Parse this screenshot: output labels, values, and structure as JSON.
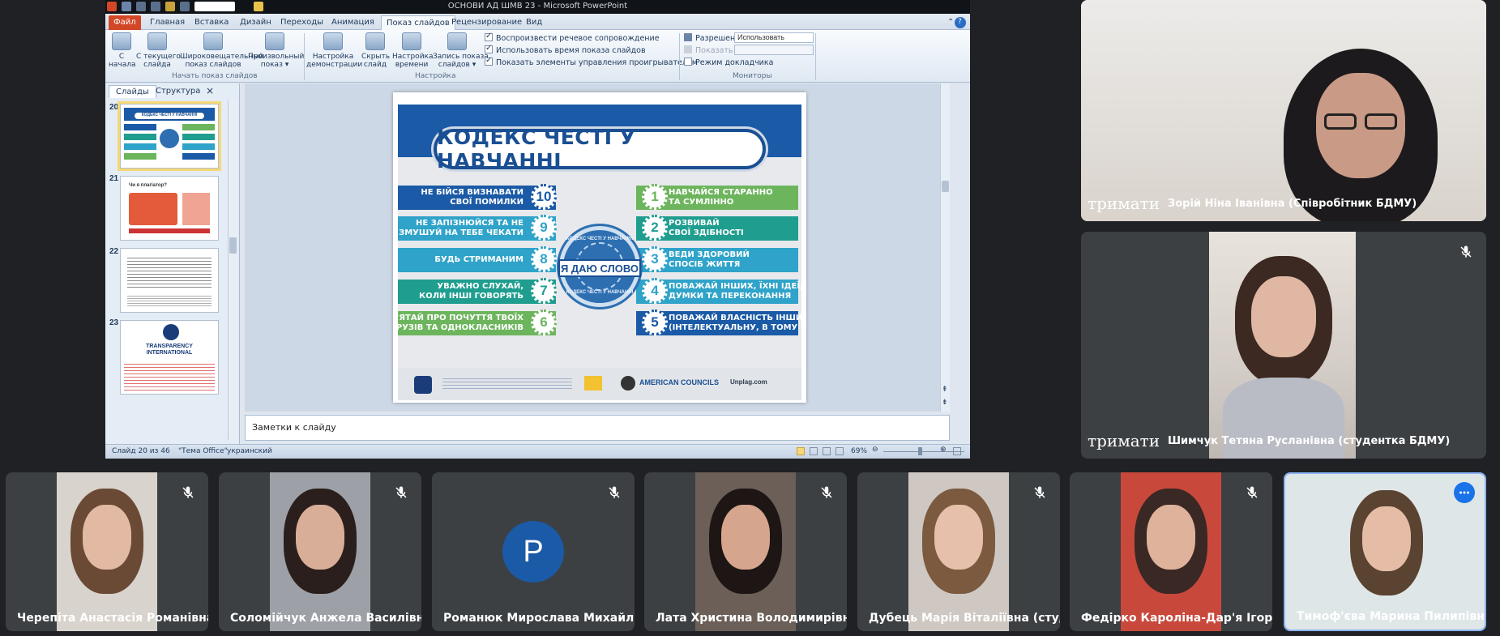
{
  "ppt": {
    "window_title": "ОСНОВИ АД ШМВ 23  -  Microsoft PowerPoint",
    "tabs": [
      "Файл",
      "Главная",
      "Вставка",
      "Дизайн",
      "Переходы",
      "Анимация",
      "Показ слайдов",
      "Рецензирование",
      "Вид"
    ],
    "active_tab": "Показ слайдов",
    "ribbon": {
      "btn_from_start": "С\nначала",
      "btn_current": "С текущего\nслайда",
      "btn_broadcast": "Широковещательный\nпоказ слайдов",
      "btn_custom": "Произвольный\nпоказ ▾",
      "group1": "Начать показ слайдов",
      "btn_setup": "Настройка\nдемонстрации",
      "btn_hide": "Скрыть\nслайд",
      "btn_timing": "Настройка\nвремени",
      "btn_record": "Запись показа\nслайдов ▾",
      "chk1": "Воспроизвести речевое сопровождение",
      "chk2": "Использовать время показа слайдов",
      "chk3": "Показать элементы управления проигрывателем",
      "group2": "Настройка",
      "resolution_label": "Разрешение:",
      "resolution_value": "Использовать текуще...",
      "show_on_label": "Показать на:",
      "presenter_view": "Режим докладчика",
      "group3": "Мониторы"
    },
    "pane": {
      "tab_slides": "Слайды",
      "tab_outline": "Структура",
      "close": "×",
      "slides": [
        "20",
        "21",
        "22",
        "23"
      ],
      "thumb20_title": "КОДЕКС ЧЕСТІ У НАВЧАННІ",
      "thumb21_title": "Чи я плагіатор?",
      "thumb23_org": "TRANSPARENCY INTERNATIONAL"
    },
    "slide": {
      "title": "КОДЕКС ЧЕСТІ У НАВЧАННІ",
      "seal_text": "Я ДАЮ СЛОВО",
      "seal_ring": "КОДЕКС ЧЕСТІ У НАВЧАННІ",
      "items_left": [
        {
          "num": "10",
          "text": "НЕ БІЙСЯ ВИЗНАВАТИ\nСВОЇ ПОМИЛКИ"
        },
        {
          "num": "9",
          "text": "НЕ ЗАПІЗНЮЙСЯ ТА НЕ\nЗМУШУЙ НА ТЕБЕ ЧЕКАТИ"
        },
        {
          "num": "8",
          "text": "БУДЬ СТРИМАНИМ"
        },
        {
          "num": "7",
          "text": "УВАЖНО СЛУХАЙ,\nКОЛИ ІНШІ ГОВОРЯТЬ"
        },
        {
          "num": "6",
          "text": "ПАМ'ЯТАЙ ПРО ПОЧУТТЯ ТВОЇХ\nДРУЗІВ ТА ОДНОКЛАСНИКІВ"
        }
      ],
      "items_right": [
        {
          "num": "1",
          "text": "НАВЧАЙСЯ СТАРАННО\nТА СУМЛІННО"
        },
        {
          "num": "2",
          "text": "РОЗВИВАЙ\nСВОЇ ЗДІБНОСТІ"
        },
        {
          "num": "3",
          "text": "ВЕДИ ЗДОРОВИЙ\nСПОСІБ ЖИТТЯ"
        },
        {
          "num": "4",
          "text": "ПОВАЖАЙ ІНШИХ, ЇХНІ ІДЕЇ,\nДУМКИ ТА ПЕРЕКОНАННЯ"
        },
        {
          "num": "5",
          "text": "ПОВАЖАЙ ВЛАСНІСТЬ ІНШИХ\n(ІНТЕЛЕКТУАЛЬНУ, В ТОМУ ЧИСЛІ)"
        }
      ],
      "footer_logos": [
        "AMERICAN COUNCILS",
        "Unplag.com"
      ]
    },
    "notes_placeholder": "Заметки к слайду",
    "status": {
      "slide_of": "Слайд 20 из 46",
      "theme": "\"Тема Office\"",
      "language": "украинский",
      "zoom": "69%"
    },
    "colors": {
      "blue": "#1a5aa6",
      "teal": "#1f9d8f",
      "green": "#6db55d",
      "lightblue": "#2fa3c9",
      "darkblue": "#1a4f93"
    }
  },
  "participants": {
    "hold_label": "тримати",
    "top1": "Зорій Ніна Іванівна (Співробітник БДМУ)",
    "top2": "Шимчук Тетяна Русланівна (студентка БДМУ)",
    "bottom": [
      "Черепіта Анастасія Романівна...",
      "Соломійчук Анжела Василівн...",
      "Романюк Мирослава Михайлі...",
      "Лата Христина Володимирівн...",
      "Дубець Марія Віталіївна (студ...",
      "Федірко Кароліна-Дар'я Ігорі...",
      "Тимоф'єва Марина Пилипівна ..."
    ],
    "avatar_letter": "P"
  }
}
